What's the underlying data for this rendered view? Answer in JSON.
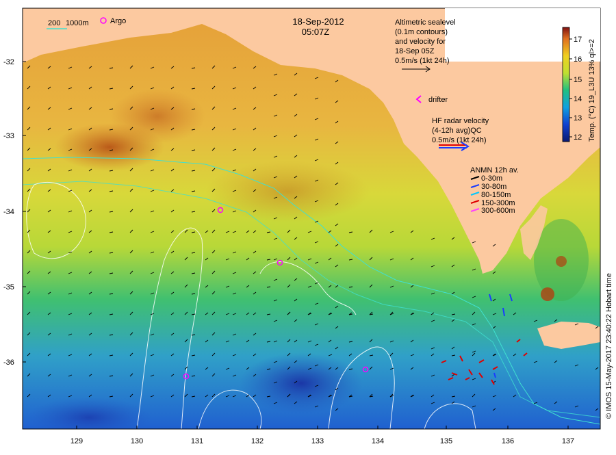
{
  "title": {
    "date": "18-Sep-2012",
    "time": "05:07Z"
  },
  "legend_top_left": {
    "isobath_label": "200",
    "isobath_label2": "1000m",
    "argo_label": "Argo"
  },
  "altimetry": {
    "line1": "Altimetric sealevel",
    "line2": "(0.1m contours)",
    "line3": "and velocity for",
    "line4": "18-Sep 05Z",
    "line5": "0.5m/s (1kt 24h)"
  },
  "drifter": {
    "label": "drifter"
  },
  "hf_radar": {
    "line1": "HF radar velocity",
    "line2": "(4-12h avg)QC",
    "line3": "0.5m/s (1kt 24h)"
  },
  "anmn": {
    "title": "ANMN 12h av.",
    "items": [
      {
        "label": "0-30m",
        "color": "#000000"
      },
      {
        "label": "30-80m",
        "color": "#1a3cff"
      },
      {
        "label": "80-150m",
        "color": "#00c8ff"
      },
      {
        "label": "150-300m",
        "color": "#e00000"
      },
      {
        "label": "300-600m",
        "color": "#ff40ff"
      }
    ]
  },
  "colorbar": {
    "label": "Temp. (°C) 19_L3U 13% ql>=2",
    "ticks": [
      "12",
      "13",
      "14",
      "15",
      "16",
      "17"
    ]
  },
  "credit": "© IMOS 15-May-2017 23:40:22 Hobart time",
  "axes": {
    "x_ticks": [
      "129",
      "130",
      "131",
      "132",
      "133",
      "134",
      "135",
      "136",
      "137"
    ],
    "y_ticks": [
      "-32",
      "-33",
      "-34",
      "-35",
      "-36"
    ]
  },
  "colors": {
    "land": "#fcc9a0",
    "argo": "#ff00ff",
    "hf_red": "#e00000",
    "hf_blue": "#1a3cff",
    "isobath": "#40e0d0"
  }
}
